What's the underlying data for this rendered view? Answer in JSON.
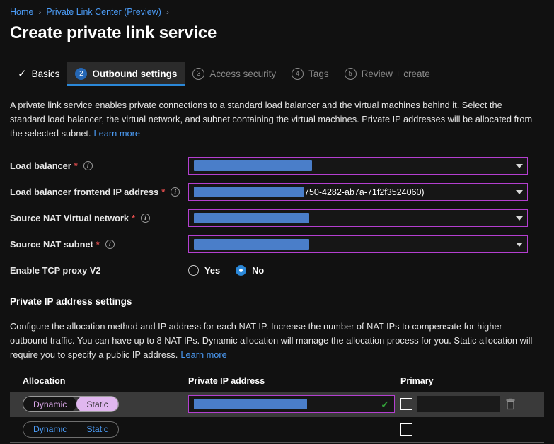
{
  "breadcrumb": {
    "items": [
      {
        "label": "Home"
      },
      {
        "label": "Private Link Center (Preview)"
      }
    ],
    "separator": "›"
  },
  "page_title": "Create private link service",
  "tabs": [
    {
      "label": "Basics",
      "marker": "✓",
      "state": "done"
    },
    {
      "label": "Outbound settings",
      "marker": "2",
      "state": "active"
    },
    {
      "label": "Access security",
      "marker": "3",
      "state": "future"
    },
    {
      "label": "Tags",
      "marker": "4",
      "state": "future"
    },
    {
      "label": "Review + create",
      "marker": "5",
      "state": "future"
    }
  ],
  "description": {
    "text": "A private link service enables private connections to a standard load balancer and the virtual machines behind it. Select the standard load balancer, the virtual network, and subnet containing the virtual machines. Private IP addresses will be allocated from the selected subnet.",
    "learn_more": "Learn more"
  },
  "form": {
    "load_balancer": {
      "label": "Load balancer",
      "required": "*",
      "info": "i",
      "value": "",
      "redacted": true,
      "redact_width": 167
    },
    "frontend_ip": {
      "label": "Load balancer frontend IP address",
      "required": "*",
      "info": "i",
      "value": "750-4282-ab7a-71f2f3524060)",
      "redacted": true,
      "redact_width": 156
    },
    "snat_vnet": {
      "label": "Source NAT Virtual network",
      "required": "*",
      "info": "i",
      "value": "",
      "redacted": true,
      "redact_width": 163
    },
    "snat_subnet": {
      "label": "Source NAT subnet",
      "required": "*",
      "info": "i",
      "value": "",
      "redacted": true,
      "redact_width": 163
    },
    "tcp_proxy": {
      "label": "Enable TCP proxy V2",
      "options": [
        {
          "label": "Yes",
          "selected": false
        },
        {
          "label": "No",
          "selected": true
        }
      ]
    }
  },
  "private_ip_section": {
    "title": "Private IP address settings",
    "description": "Configure the allocation method and IP address for each NAT IP. Increase the number of NAT IPs to compensate for higher outbound traffic. You can have up to 8 NAT IPs. Dynamic allocation will manage the allocation process for you. Static allocation will require you to specify a public IP address.",
    "learn_more": "Learn more",
    "columns": [
      "Allocation",
      "Private IP address",
      "Primary"
    ],
    "rows": [
      {
        "allocation": {
          "dynamic": "Dynamic",
          "static": "Static",
          "selected": "Static",
          "highlighted": true
        },
        "ip_address": {
          "value": "",
          "redacted": true,
          "redact_width": 160,
          "valid": true,
          "valid_mark": "✓"
        },
        "primary_checked": false,
        "has_delete": true,
        "row_selected": true
      },
      {
        "allocation": {
          "dynamic": "Dynamic",
          "static": "Static",
          "selected": "",
          "highlighted": false
        },
        "ip_address": {
          "value": "",
          "redacted": false,
          "redact_width": 0,
          "valid": false,
          "valid_mark": ""
        },
        "primary_checked": false,
        "has_delete": false,
        "row_selected": false
      }
    ]
  },
  "colors": {
    "background": "#111111",
    "link": "#4b9bf5",
    "accent_tab": "#2b88d8",
    "required_star": "#e04c4c",
    "focus_border": "#b43fd0",
    "selection_blue": "#4a7ec9",
    "pill_active": "#e0b7ef",
    "valid_green": "#33a33a"
  }
}
